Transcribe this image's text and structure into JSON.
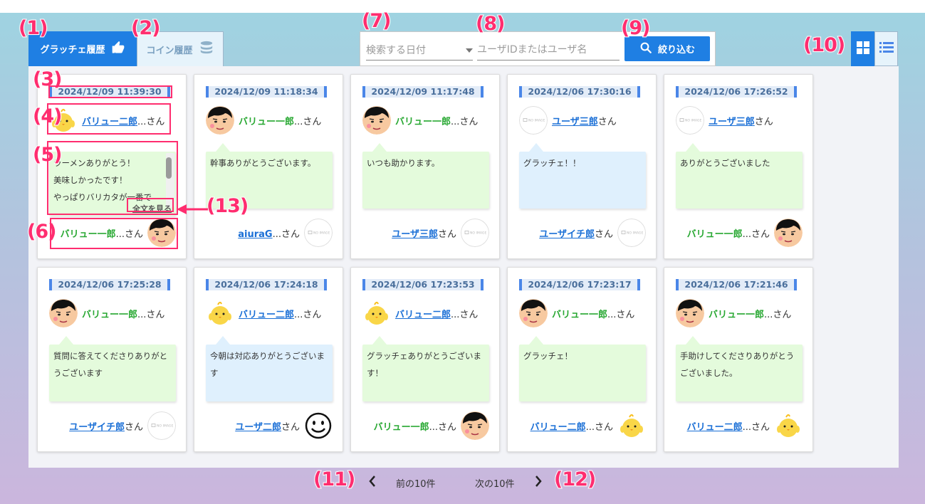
{
  "tabs": [
    {
      "label": "グラッチェ履歴",
      "icon": "thumbs-up-icon",
      "active": true
    },
    {
      "label": "コイン履歴",
      "icon": "coins-icon",
      "active": false
    }
  ],
  "filter": {
    "date_placeholder": "検索する日付",
    "user_placeholder": "ユーザIDまたはユーザ名",
    "button_label": "絞り込む"
  },
  "view_modes": [
    "grid-view-icon",
    "list-view-icon"
  ],
  "san": "さん",
  "cards": [
    {
      "date": "2024/12/09 11:39:30",
      "sender": {
        "name": "バリュー二郎",
        "suffix": "...",
        "style": "link",
        "avatar": "chick"
      },
      "message": [
        "ラーメンありがとう！",
        "美味しかったです！",
        "やっぱりバリカタが一番で"
      ],
      "bubble": "green",
      "scroll": true,
      "fulltext": "全文を見る",
      "receiver": {
        "name": "バリュー一郎",
        "suffix": "...",
        "style": "green",
        "avatar": "face"
      }
    },
    {
      "date": "2024/12/09 11:18:34",
      "sender": {
        "name": "バリュー一郎",
        "suffix": "...",
        "style": "green",
        "avatar": "face"
      },
      "message": [
        "幹事ありがとうございます。"
      ],
      "bubble": "green",
      "receiver": {
        "name": "aiuraG",
        "suffix": "...",
        "style": "link",
        "avatar": "noimage"
      }
    },
    {
      "date": "2024/12/09 11:17:48",
      "sender": {
        "name": "バリュー一郎",
        "suffix": "...",
        "style": "green",
        "avatar": "face"
      },
      "message": [
        "いつも助かります。"
      ],
      "bubble": "green",
      "receiver": {
        "name": "ユーザ三郎",
        "suffix": "",
        "style": "link",
        "avatar": "noimage"
      }
    },
    {
      "date": "2024/12/06 17:30:16",
      "sender": {
        "name": "ユーザ三郎",
        "suffix": "",
        "style": "link",
        "avatar": "noimage"
      },
      "message": [
        "グラッチェ！！"
      ],
      "bubble": "blue",
      "receiver": {
        "name": "ユーザイチ郎",
        "suffix": "",
        "style": "link",
        "avatar": "noimage"
      }
    },
    {
      "date": "2024/12/06 17:26:52",
      "sender": {
        "name": "ユーザ三郎",
        "suffix": "",
        "style": "link",
        "avatar": "noimage"
      },
      "message": [
        "ありがとうございました"
      ],
      "bubble": "green",
      "receiver": {
        "name": "バリュー一郎",
        "suffix": "...",
        "style": "green",
        "avatar": "face"
      }
    },
    {
      "date": "2024/12/06 17:25:28",
      "sender": {
        "name": "バリュー一郎",
        "suffix": "...",
        "style": "green",
        "avatar": "face"
      },
      "message": [
        "質問に答えてくださりありがと",
        "うございます"
      ],
      "bubble": "green",
      "receiver": {
        "name": "ユーザイチ郎",
        "suffix": "",
        "style": "link",
        "avatar": "noimage"
      }
    },
    {
      "date": "2024/12/06 17:24:18",
      "sender": {
        "name": "バリュー二郎",
        "suffix": "...",
        "style": "link",
        "avatar": "chick"
      },
      "message": [
        "今朝は対応ありがとうございま",
        "す"
      ],
      "bubble": "blue",
      "receiver": {
        "name": "ユーザ二郎",
        "suffix": "",
        "style": "link",
        "avatar": "smiley"
      }
    },
    {
      "date": "2024/12/06 17:23:53",
      "sender": {
        "name": "バリュー二郎",
        "suffix": "...",
        "style": "link",
        "avatar": "chick"
      },
      "message": [
        "グラッチェありがとうございま",
        "す！"
      ],
      "bubble": "green",
      "receiver": {
        "name": "バリュー一郎",
        "suffix": "...",
        "style": "green",
        "avatar": "face"
      }
    },
    {
      "date": "2024/12/06 17:23:17",
      "sender": {
        "name": "バリュー一郎",
        "suffix": "...",
        "style": "green",
        "avatar": "face"
      },
      "message": [
        "グラッチェ！"
      ],
      "bubble": "green",
      "receiver": {
        "name": "バリュー二郎",
        "suffix": "...",
        "style": "link",
        "avatar": "chick"
      }
    },
    {
      "date": "2024/12/06 17:21:46",
      "sender": {
        "name": "バリュー一郎",
        "suffix": "...",
        "style": "green",
        "avatar": "face"
      },
      "message": [
        "手助けしてくださりありがとう",
        "ございました。"
      ],
      "bubble": "green",
      "receiver": {
        "name": "バリュー二郎",
        "suffix": "...",
        "style": "link",
        "avatar": "chick"
      }
    }
  ],
  "pagination": {
    "prev": "前の10件",
    "next": "次の10件"
  },
  "annotations": [
    "(1)",
    "(2)",
    "(3)",
    "(4)",
    "(5)",
    "(6)",
    "(7)",
    "(8)",
    "(9)",
    "(10)",
    "(11)",
    "(12)",
    "(13)"
  ],
  "colors": {
    "accent": "#1f7fe3",
    "annotation": "#ff2d6f",
    "green_name": "#28a832",
    "link": "#1a6fd6"
  },
  "no_image_text": "NO IMAGE"
}
